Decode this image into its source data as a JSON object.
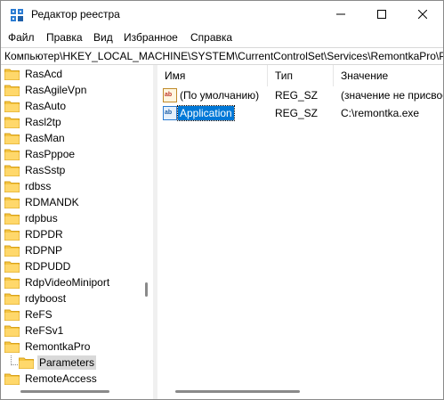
{
  "window": {
    "title": "Редактор реестра",
    "controls": {
      "minimize": "minimize-icon",
      "maximize": "maximize-icon",
      "close": "close-icon"
    }
  },
  "menu": {
    "items": [
      {
        "label": "Файл"
      },
      {
        "label": "Правка"
      },
      {
        "label": "Вид"
      },
      {
        "label": "Избранное"
      },
      {
        "label": "Справка"
      }
    ]
  },
  "address": {
    "path": "Компьютер\\HKEY_LOCAL_MACHINE\\SYSTEM\\CurrentControlSet\\Services\\RemontkaPro\\Parameters"
  },
  "tree": {
    "items": [
      {
        "label": "RasAcd"
      },
      {
        "label": "RasAgileVpn"
      },
      {
        "label": "RasAuto"
      },
      {
        "label": "Rasl2tp"
      },
      {
        "label": "RasMan"
      },
      {
        "label": "RasPppoe"
      },
      {
        "label": "RasSstp"
      },
      {
        "label": "rdbss"
      },
      {
        "label": "RDMANDK"
      },
      {
        "label": "rdpbus"
      },
      {
        "label": "RDPDR"
      },
      {
        "label": "RDPNP"
      },
      {
        "label": "RDPUDD"
      },
      {
        "label": "RdpVideoMiniport"
      },
      {
        "label": "rdyboost"
      },
      {
        "label": "ReFS"
      },
      {
        "label": "ReFSv1"
      },
      {
        "label": "RemontkaPro"
      },
      {
        "label": "Parameters",
        "selected": true
      },
      {
        "label": "RemoteAccess"
      }
    ]
  },
  "list": {
    "columns": {
      "name": "Имя",
      "type": "Тип",
      "value": "Значение"
    },
    "rows": [
      {
        "name": "(По умолчанию)",
        "type": "REG_SZ",
        "value": "(значение не присвоено)",
        "icon": "string-value-icon"
      },
      {
        "name": "Application",
        "type": "REG_SZ",
        "value": "C:\\remontka.exe",
        "icon": "string-value-icon",
        "selected": true
      }
    ]
  },
  "colors": {
    "selection": "#0078d7",
    "folder": "#f5c542",
    "tree_selected": "#d9d9d9"
  }
}
